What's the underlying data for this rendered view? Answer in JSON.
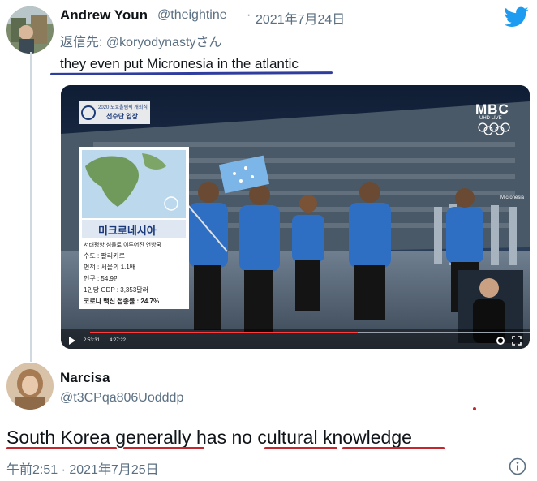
{
  "tweet1": {
    "author_name": "Andrew Youn",
    "handle": "@theightine",
    "separator": "·",
    "date": "2021年7月24日",
    "reply_to": "返信先: @koryodynastyさん",
    "text": "they even put Micronesia in the atlantic"
  },
  "video": {
    "top_tag": "2020 도쿄올림픽 개회식",
    "top_title": "선수단 입장",
    "broadcaster": "MBC",
    "broadcaster_sub": "UHD LIVE",
    "country_name": "미크로네시아",
    "info_lines": [
      "서태평양 섬들로 이루어진 연방국",
      "수도 : 팔리키르",
      "면적 : 서울의 1.1배",
      "인구 : 54.9만",
      "1인당 GDP : 3,353달러",
      "코로나 백신 접종률 : 24.7%"
    ],
    "time_current": "2:53:31",
    "time_total": "4:27:22",
    "flag_label": "Micronesia"
  },
  "tweet2": {
    "author_name": "Narcisa",
    "handle": "@t3CPqa806Uodddp",
    "text": "South Korea generally has no cultural knowledge",
    "timestamp": "午前2:51 · 2021年7月25日"
  },
  "colors": {
    "twitter_blue": "#1d9bf0",
    "underline_blue": "#2f3e9e",
    "underline_red": "#c4262e",
    "muted": "#5b7083"
  },
  "icons": {
    "brand": "twitter-bird-icon",
    "info": "info-icon"
  }
}
